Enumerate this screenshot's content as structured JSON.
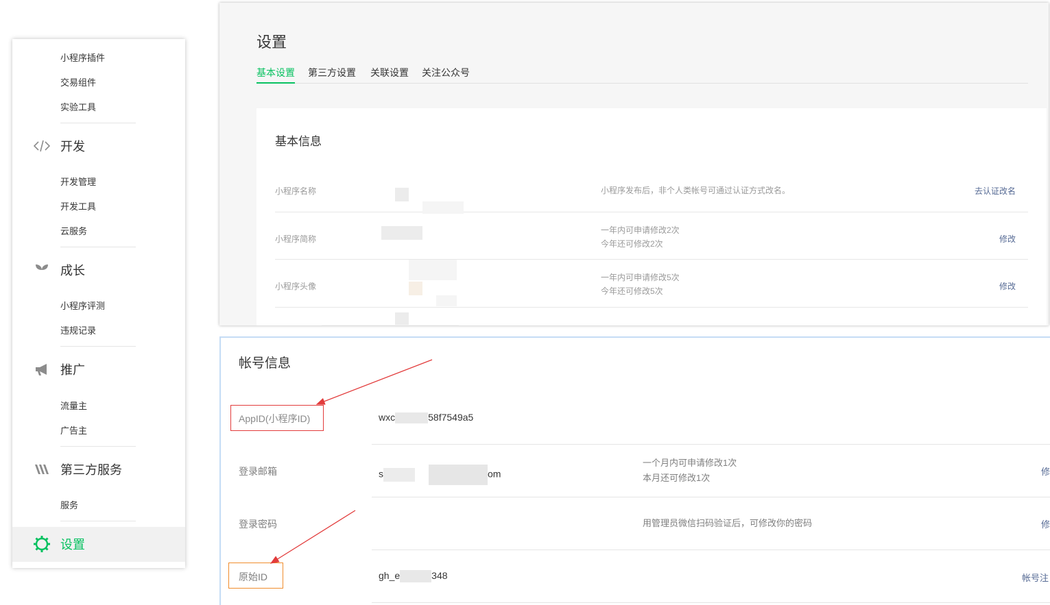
{
  "sidebar": {
    "top_items": [
      "小程序插件",
      "交易组件",
      "实验工具"
    ],
    "groups": [
      {
        "label": "开发",
        "icon": "code-icon",
        "items": [
          "开发管理",
          "开发工具",
          "云服务"
        ]
      },
      {
        "label": "成长",
        "icon": "sprout-icon",
        "items": [
          "小程序评测",
          "违规记录"
        ]
      },
      {
        "label": "推广",
        "icon": "megaphone-icon",
        "items": [
          "流量主",
          "广告主"
        ]
      },
      {
        "label": "第三方服务",
        "icon": "third-party-icon",
        "items": [
          "服务"
        ]
      }
    ],
    "active": {
      "label": "设置",
      "icon": "gear-icon"
    }
  },
  "settings": {
    "title": "设置",
    "tabs": [
      "基本设置",
      "第三方设置",
      "关联设置",
      "关注公众号"
    ],
    "active_tab": "基本设置"
  },
  "basic_info": {
    "title": "基本信息",
    "rows": [
      {
        "label": "小程序名称",
        "desc_1": "小程序发布后，非个人类帐号可通过认证方式改名。",
        "desc_2": "",
        "action": "去认证改名"
      },
      {
        "label": "小程序简称",
        "desc_1": "一年内可申请修改2次",
        "desc_2": "今年还可修改2次",
        "action": "修改"
      },
      {
        "label": "小程序头像",
        "desc_1": "一年内可申请修改5次",
        "desc_2": "今年还可修改5次",
        "action": "修改"
      }
    ]
  },
  "account_info": {
    "title": "帐号信息",
    "appid_label": "AppID(小程序ID)",
    "appid_prefix": "wxc",
    "appid_suffix": "58f7549a5",
    "email_label": "登录邮箱",
    "email_prefix": "s",
    "email_suffix": "om",
    "email_desc_1": "一个月内可申请修改1次",
    "email_desc_2": "本月还可修改1次",
    "email_action": "修",
    "password_label": "登录密码",
    "password_desc": "用管理员微信扫码验证后，可修改你的密码",
    "password_action": "修",
    "origin_label": "原始ID",
    "origin_prefix": "gh_e",
    "origin_suffix": "348",
    "origin_action": "帐号注"
  },
  "colors": {
    "accent": "#07c160",
    "link": "#576b95",
    "annotation_red": "#e23b3b",
    "annotation_orange": "#f08c2b"
  }
}
